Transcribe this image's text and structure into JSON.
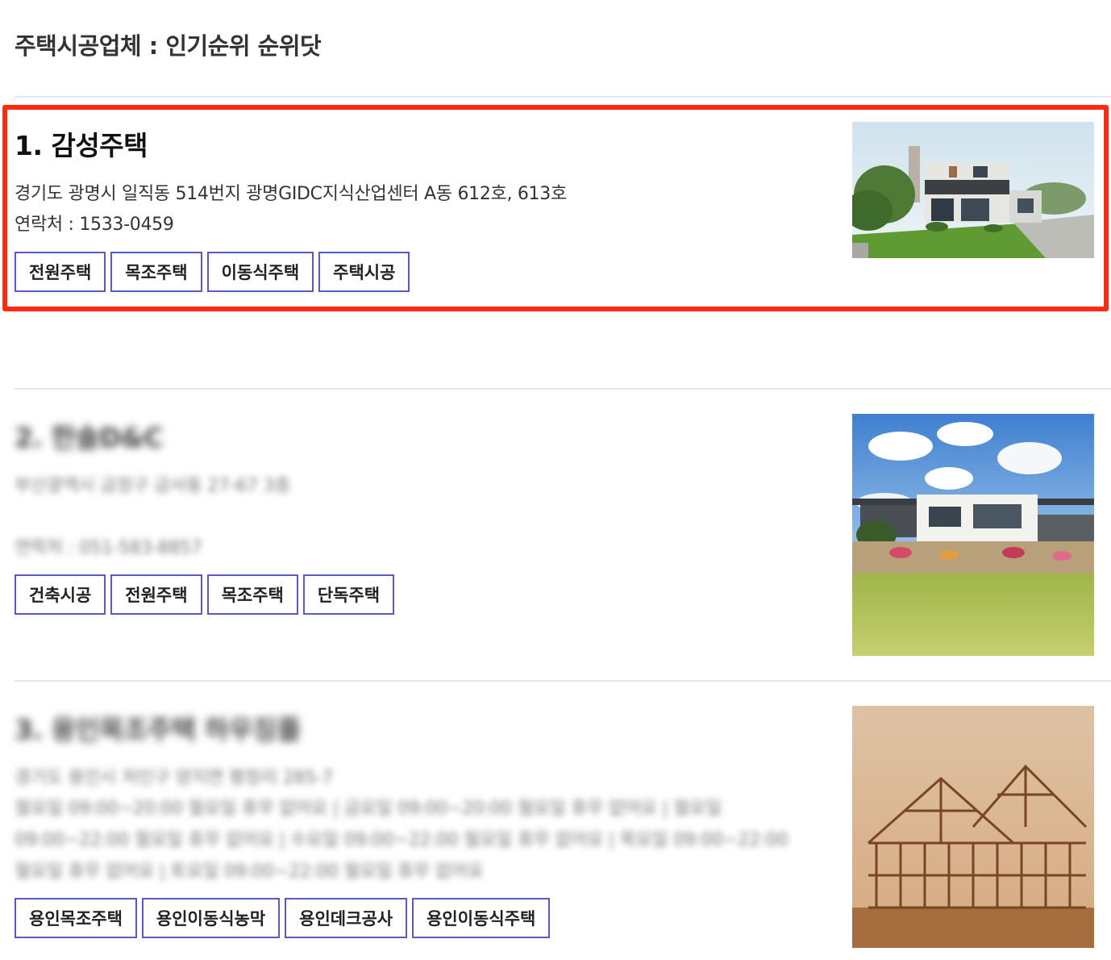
{
  "page": {
    "title": "주택시공업체 : 인기순위 순위닷"
  },
  "listings": [
    {
      "title": "1. 감성주택",
      "address": "경기도 광명시 일직동 514번지 광명GIDC지식산업센터 A동 612호, 613호",
      "contact": "연락처 : 1533-0459",
      "tags": [
        "전원주택",
        "목조주택",
        "이동식주택",
        "주택시공"
      ],
      "image_icon": "modern-house-photo"
    },
    {
      "title": "2. 한솔D&C",
      "address": "부산광역시 금정구 금사동 27-67 3층",
      "contact": "연락처 : 051-583-8857",
      "tags": [
        "건축시공",
        "전원주택",
        "목조주택",
        "단독주택"
      ],
      "image_icon": "villa-photo"
    },
    {
      "title": "3. 용인목조주택 하우징플",
      "address": "경기도 용인시 처인구 양지면 평창리 285-7",
      "hours_1": "월요일 09:00~20:00 월요일 휴무 없어요 | 금요일 09:00~20:00 월요일 휴무 없어요 | 월요일",
      "hours_2": "09:00~22:00 월요일 휴무 없어요 | 수요일 09:00~22:00 월요일 휴무 없어요 | 목요일 09:00~22:00",
      "hours_3": "월요일 휴무 없어요 | 토요일 09:00~22:00 월요일 휴무 없어요",
      "tags": [
        "용인목조주택",
        "용인이동식농막",
        "용인데크공사",
        "용인이동식주택"
      ],
      "image_icon": "timber-frame-photo"
    }
  ],
  "colors": {
    "tag_border": "#5a5ac4",
    "highlight": "#ff2a10",
    "divider": "#e6e6e6"
  }
}
